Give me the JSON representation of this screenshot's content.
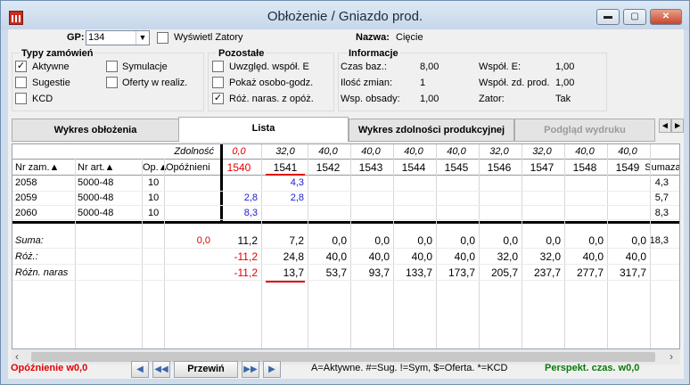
{
  "window": {
    "title": "Obłożenie / Gniazdo prod.",
    "min": "▬",
    "max": "▢",
    "close": "✕"
  },
  "top": {
    "gp_label": "GP:",
    "gp_value": "134",
    "show_blocks_label": "Wyświetl Zatory",
    "name_label": "Nazwa:",
    "name_value": "Cięcie"
  },
  "order_types": {
    "title": "Typy zamówień",
    "active": "Aktywne",
    "simulation": "Symulacje",
    "suggestions": "Sugestie",
    "offers": "Oferty w realiz.",
    "kcd": "KCD"
  },
  "others": {
    "title": "Pozostałe",
    "include_coef": "Uwzględ. współ. E",
    "show_person_hours": "Pokaż osobo-godz.",
    "cum_diff": "Róż. naras. z opóż."
  },
  "info": {
    "title": "Informacje",
    "base_time_l": "Czas baz.:",
    "base_time_v": "8,00",
    "coef_e_l": "Współ. E:",
    "coef_e_v": "1,00",
    "shifts_l": "Ilość zmian:",
    "shifts_v": "1",
    "coef_capacity_l": "Współ. zd. prod.",
    "coef_capacity_v": "1,00",
    "staff_coef_l": "Wsp. obsady:",
    "staff_coef_v": "1,00",
    "block_l": "Zator:",
    "block_v": "Tak"
  },
  "tabs": {
    "t1": "Wykres obłożenia",
    "t2": "Lista",
    "t3": "Wykres zdolności produkcyjnej",
    "t4": "Podgląd wydruku",
    "prev": "◂",
    "next": "▸"
  },
  "grid": {
    "h_capacity": "Zdolność",
    "h_order": "Nr zam.▲",
    "h_article": "Nr art.▲",
    "h_op": "Op.▲",
    "h_delay": "Opóźnieni",
    "h_sum": "Suma",
    "h_extra": "zas",
    "capacity": [
      "0,0",
      "32,0",
      "40,0",
      "40,0",
      "40,0",
      "40,0",
      "32,0",
      "32,0",
      "40,0",
      "40,0"
    ],
    "weeks": [
      "1540",
      "1541",
      "1542",
      "1543",
      "1544",
      "1545",
      "1546",
      "1547",
      "1548",
      "1549"
    ],
    "rows": [
      {
        "order": "2058",
        "article": "5000-48",
        "op": "10",
        "vals": [
          "",
          "4,3",
          "",
          "",
          "",
          "",
          "",
          "",
          "",
          ""
        ],
        "sum": "4,3"
      },
      {
        "order": "2059",
        "article": "5000-48",
        "op": "10",
        "vals": [
          "2,8",
          "2,8",
          "",
          "",
          "",
          "",
          "",
          "",
          "",
          ""
        ],
        "sum": "5,7"
      },
      {
        "order": "2060",
        "article": "5000-48",
        "op": "10",
        "vals": [
          "8,3",
          "",
          "",
          "",
          "",
          "",
          "",
          "",
          "",
          ""
        ],
        "sum": "8,3"
      }
    ],
    "suma": {
      "label": "Suma:",
      "delay": "0,0",
      "vals": [
        "11,2",
        "7,2",
        "0,0",
        "0,0",
        "0,0",
        "0,0",
        "0,0",
        "0,0",
        "0,0",
        "0,0"
      ],
      "sum": "18,3"
    },
    "roz": {
      "label": "Róż.:",
      "vals": [
        "-11,2",
        "24,8",
        "40,0",
        "40,0",
        "40,0",
        "40,0",
        "32,0",
        "32,0",
        "40,0",
        "40,0"
      ]
    },
    "roznaras": {
      "label": "Różn. naras",
      "vals": [
        "-11,2",
        "13,7",
        "53,7",
        "93,7",
        "133,7",
        "173,7",
        "205,7",
        "237,7",
        "277,7",
        "317,7"
      ]
    }
  },
  "bottom": {
    "delay": "Opóźnienie w0,0",
    "prev_label": "Przewiń",
    "legend": "A=Aktywne. #=Sug. !=Sym, $=Oferta. *=KCD",
    "perspective": "Perspekt. czas. w0,0"
  },
  "colors": {
    "red": "#e00000",
    "blue": "#1a1ad0",
    "green": "#0a7a0a"
  }
}
